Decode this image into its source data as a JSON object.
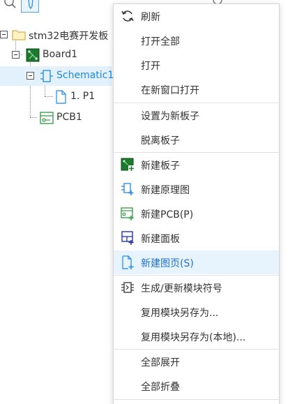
{
  "tree": {
    "items": [
      {
        "label": "stm32电赛开发板",
        "icon": "folder-icon"
      },
      {
        "label": "Board1",
        "icon": "board-icon"
      },
      {
        "label": "Schematic1",
        "icon": "schematic-icon",
        "selected": true
      },
      {
        "label": "1. P1",
        "icon": "page-icon"
      },
      {
        "label": "PCB1",
        "icon": "pcb-icon"
      }
    ]
  },
  "menu": {
    "items": [
      {
        "label": "刷新",
        "icon": "refresh-icon"
      },
      {
        "label": "打开全部",
        "icon": ""
      },
      {
        "label": "打开",
        "icon": ""
      },
      {
        "label": "在新窗口打开",
        "icon": ""
      },
      {
        "label": "设置为新板子",
        "icon": ""
      },
      {
        "label": "脱离板子",
        "icon": ""
      },
      {
        "label": "新建板子",
        "icon": "new-board-icon"
      },
      {
        "label": "新建原理图",
        "icon": "new-schematic-icon"
      },
      {
        "label": "新建PCB(P)",
        "icon": "new-pcb-icon"
      },
      {
        "label": "新建面板",
        "icon": "new-panel-icon"
      },
      {
        "label": "新建图页(S)",
        "icon": "new-page-icon",
        "hover": true
      },
      {
        "label": "生成/更新模块符号",
        "icon": "module-symbol-icon"
      },
      {
        "label": "复用模块另存为...",
        "icon": ""
      },
      {
        "label": "复用模块另存为(本地)...",
        "icon": ""
      },
      {
        "label": "全部展开",
        "icon": ""
      },
      {
        "label": "全部折叠",
        "icon": ""
      }
    ]
  },
  "colors": {
    "accent": "#1e88e5",
    "selection_bg": "#e3f1fc",
    "hover_bg": "#e8f4fd",
    "board_green": "#1b7a2c",
    "panel_blue": "#2233aa"
  }
}
